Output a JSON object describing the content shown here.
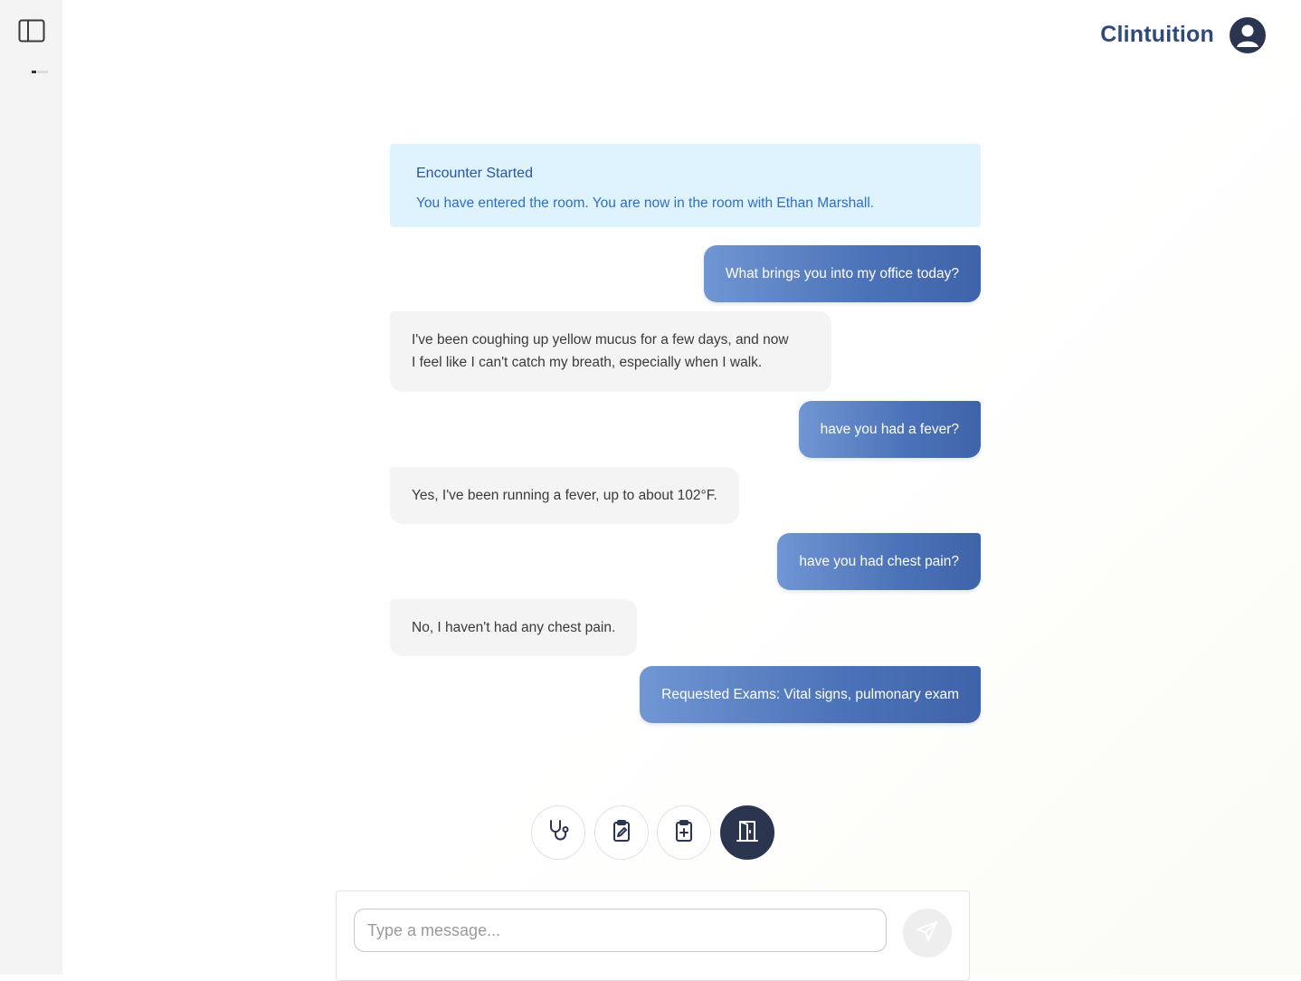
{
  "app": {
    "brand": "Clintuition"
  },
  "encounter": {
    "title": "Encounter Started",
    "text": "You have entered the room. You are now in the room with Ethan Marshall."
  },
  "messages": [
    {
      "role": "user",
      "text": "What brings you into my office today?"
    },
    {
      "role": "patient",
      "line1": "I've been coughing up yellow mucus for a few days, and now",
      "line2": "I feel like I can't catch my breath, especially when I walk."
    },
    {
      "role": "user",
      "text": "have you had a fever?"
    },
    {
      "role": "patient",
      "text": "Yes, I've been running a fever, up to about 102°F."
    },
    {
      "role": "user",
      "text": "have you had chest pain?"
    },
    {
      "role": "patient",
      "text": "No, I haven't had any chest pain."
    },
    {
      "role": "user",
      "text": "Requested Exams: Vital signs, pulmonary exam"
    }
  ],
  "toolbar": {
    "icons": [
      "stethoscope-icon",
      "clipboard-pen-icon",
      "clipboard-plus-icon",
      "door-exit-icon"
    ],
    "active_index": 3
  },
  "composer": {
    "placeholder": "Type a message...",
    "value": ""
  },
  "icons": {
    "sidebar": "sidebar-panel-icon",
    "avatar": "user-avatar-icon",
    "send": "send-icon"
  },
  "colors": {
    "brand": "#2f4a7a",
    "user_bubble": "#4b72b8",
    "patient_bubble": "#f4f4f4",
    "encounter_bg": "#dff3fe",
    "encounter_text": "#2f6ec7",
    "dark_button": "#2b3550"
  }
}
